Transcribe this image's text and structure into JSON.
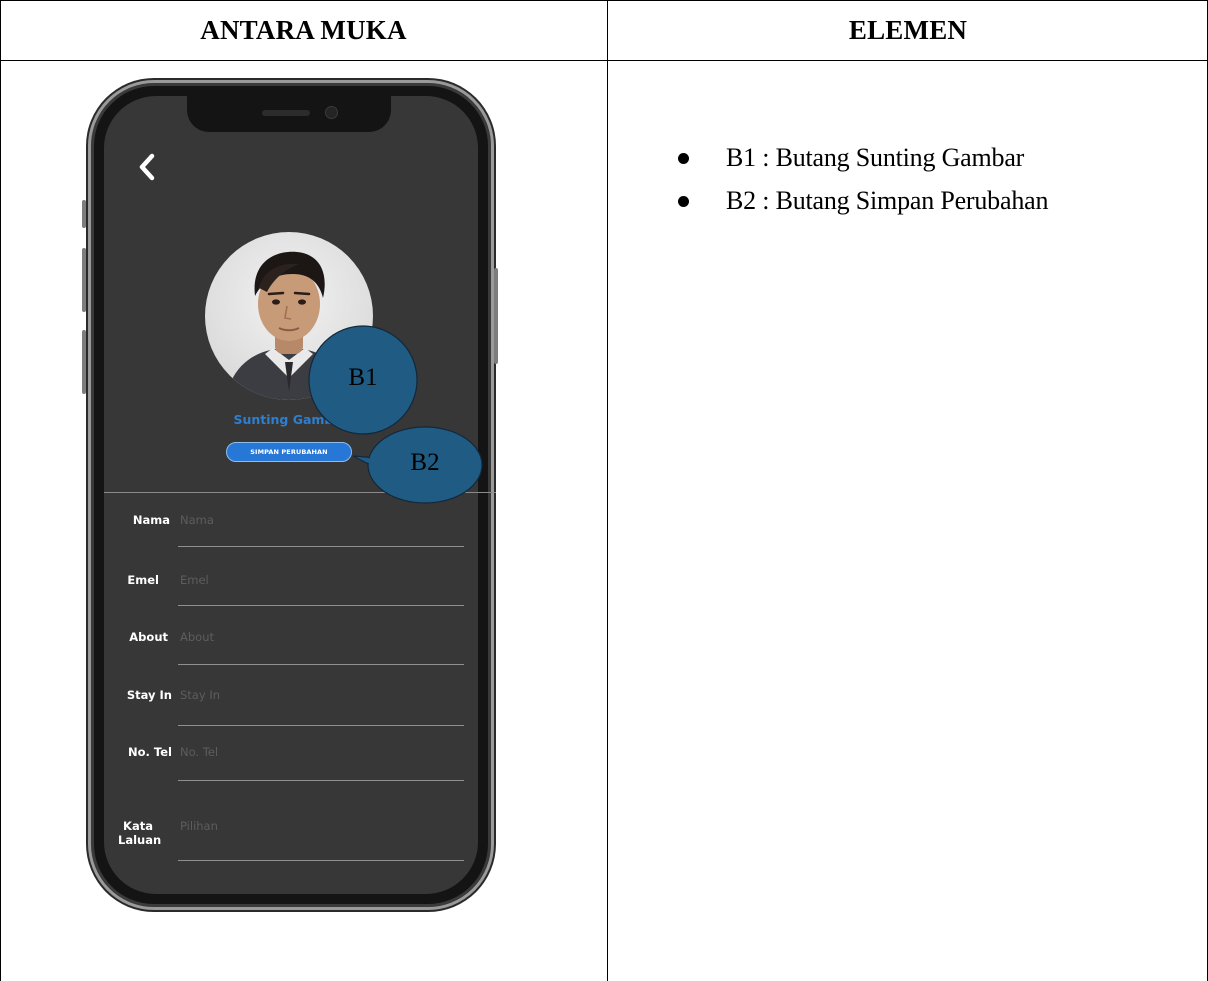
{
  "table": {
    "header_left": "ANTARA MUKA",
    "header_right": "ELEMEN"
  },
  "phone_screen": {
    "edit_photo_label": "Sunting Gamba.",
    "save_button_label": "SIMPAN PERUBAHAN",
    "fields": [
      {
        "label": "Nama",
        "placeholder": "Nama",
        "value": ""
      },
      {
        "label": "Emel",
        "placeholder": "Emel",
        "value": ""
      },
      {
        "label": "About",
        "placeholder": "About",
        "value": ""
      },
      {
        "label": "Stay In",
        "placeholder": "Stay In",
        "value": ""
      },
      {
        "label": "No. Tel",
        "placeholder": "No. Tel",
        "value": ""
      },
      {
        "label": "Kata Laluan",
        "placeholder": "Pilihan",
        "value": ""
      }
    ],
    "icons": {
      "back": "chevron-left-icon"
    }
  },
  "callouts": [
    {
      "id": "B1",
      "color": "#1f5b83"
    },
    {
      "id": "B2",
      "color": "#1f5b83"
    }
  ],
  "elements": [
    "B1 : Butang Sunting Gambar",
    "B2 : Butang Simpan Perubahan"
  ]
}
